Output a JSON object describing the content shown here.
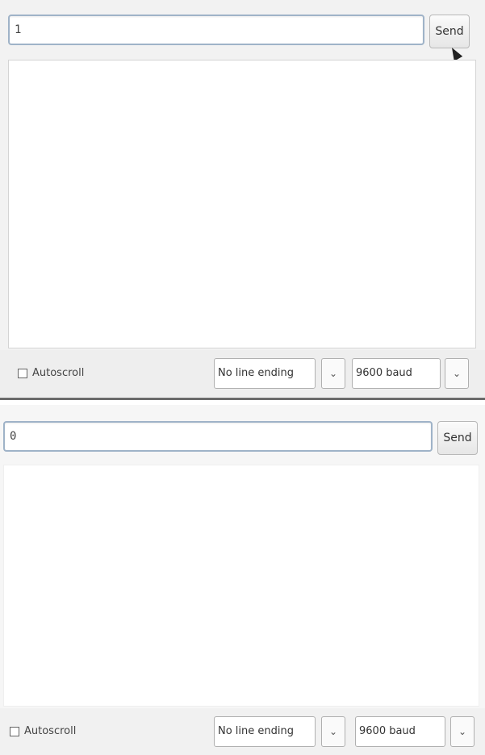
{
  "panels": [
    {
      "input_value": "1",
      "send_label": "Send",
      "autoscroll_label": "Autoscroll",
      "line_ending": "No line ending",
      "baud_rate": "9600 baud",
      "dropdown_arrow": "⌄"
    },
    {
      "input_value": "0",
      "send_label": "Send",
      "autoscroll_label": "Autoscroll",
      "line_ending": "No line ending",
      "baud_rate": "9600 baud",
      "dropdown_arrow": "⌄"
    }
  ]
}
